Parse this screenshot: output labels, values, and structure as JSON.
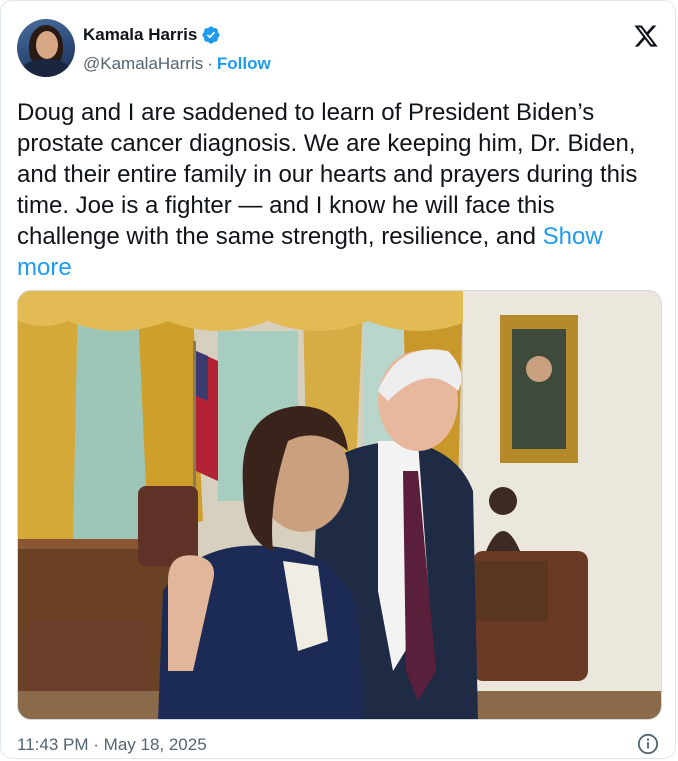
{
  "author": {
    "name": "Kamala Harris",
    "handle": "@KamalaHarris",
    "separator": "·",
    "follow_label": "Follow",
    "avatar_icon": "profile-avatar",
    "verified_icon": "verified-badge-icon"
  },
  "brand": {
    "logo_icon": "x-logo-icon"
  },
  "tweet": {
    "text": "Doug and I are saddened to learn of President Biden’s prostate cancer diagnosis. We are keeping him, Dr. Biden, and their entire family in our hearts and prayers during this time. Joe is a fighter — and I know he will face this challenge with the same strength, resilience, and ",
    "show_more_label": "Show more"
  },
  "media": {
    "type": "photo"
  },
  "footer": {
    "time": "11:43 PM",
    "separator": "·",
    "date": "May 18, 2025",
    "info_icon": "info-icon"
  },
  "colors": {
    "accent": "#1d9bf0",
    "text": "#0f1419",
    "secondary_text": "#536471",
    "border": "#cfd9de"
  }
}
